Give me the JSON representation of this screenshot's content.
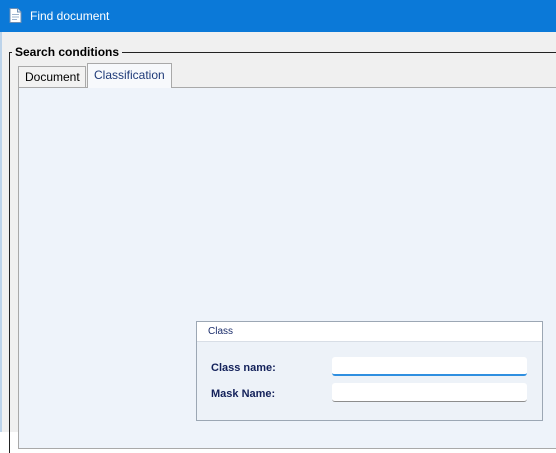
{
  "window": {
    "title": "Find document"
  },
  "search_conditions": {
    "title": "Search conditions"
  },
  "tabs": [
    {
      "label": "Document",
      "active": false
    },
    {
      "label": "Classification",
      "active": true
    }
  ],
  "class_group": {
    "title": "Class",
    "fields": [
      {
        "label": "Class name:",
        "value": "",
        "focused": true
      },
      {
        "label": "Mask Name:",
        "value": ""
      }
    ]
  },
  "colors": {
    "titlebar": "#0b79d8",
    "panel": "#eef3fa",
    "focus_underline": "#2f8fe0"
  }
}
